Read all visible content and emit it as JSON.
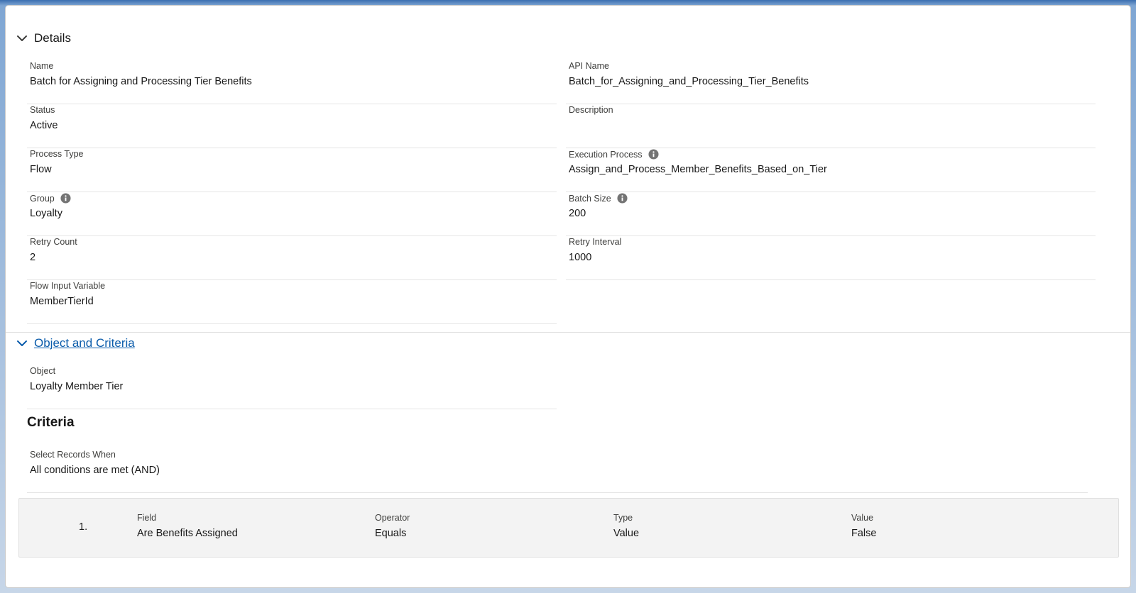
{
  "details": {
    "title": "Details",
    "fields": {
      "name": {
        "label": "Name",
        "value": "Batch for Assigning and Processing Tier Benefits"
      },
      "api_name": {
        "label": "API Name",
        "value": "Batch_for_Assigning_and_Processing_Tier_Benefits"
      },
      "status": {
        "label": "Status",
        "value": "Active"
      },
      "description": {
        "label": "Description",
        "value": ""
      },
      "process_type": {
        "label": "Process Type",
        "value": "Flow"
      },
      "execution_process": {
        "label": "Execution Process",
        "value": "Assign_and_Process_Member_Benefits_Based_on_Tier"
      },
      "group": {
        "label": "Group",
        "value": "Loyalty"
      },
      "batch_size": {
        "label": "Batch Size",
        "value": "200"
      },
      "retry_count": {
        "label": "Retry Count",
        "value": "2"
      },
      "retry_interval": {
        "label": "Retry Interval",
        "value": "1000"
      },
      "flow_input_variable": {
        "label": "Flow Input Variable",
        "value": "MemberTierId"
      }
    }
  },
  "object_criteria": {
    "title": "Object and Criteria",
    "object": {
      "label": "Object",
      "value": "Loyalty Member Tier"
    },
    "criteria_title": "Criteria",
    "select_records": {
      "label": "Select Records When",
      "value": "All conditions are met (AND)"
    },
    "conditions": [
      {
        "number": "1.",
        "field_label": "Field",
        "field_value": "Are Benefits Assigned",
        "operator_label": "Operator",
        "operator_value": "Equals",
        "type_label": "Type",
        "type_value": "Value",
        "value_label": "Value",
        "value_value": "False"
      }
    ]
  },
  "colors": {
    "link": "#0b5cab",
    "text": "#181818",
    "label": "#3e3e3c",
    "icon": "#747474"
  },
  "icons": {
    "chevron": "chevron-down-icon",
    "info": "info-icon"
  }
}
